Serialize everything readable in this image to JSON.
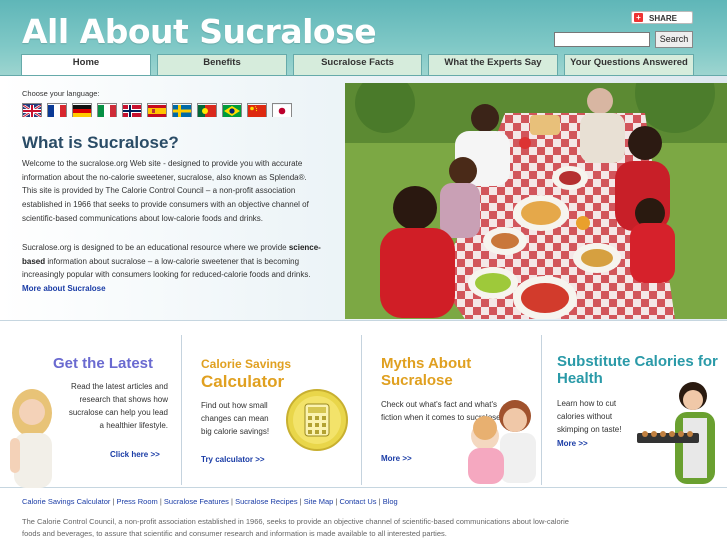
{
  "header": {
    "logo": "All About Sucralose",
    "share_label": "SHARE",
    "search_placeholder": "",
    "search_button": "Search"
  },
  "nav": {
    "tabs": [
      {
        "label": "Home"
      },
      {
        "label": "Benefits"
      },
      {
        "label": "Sucralose Facts"
      },
      {
        "label": "What the Experts Say"
      },
      {
        "label": "Your Questions Answered"
      }
    ]
  },
  "language": {
    "label": "Choose your language:",
    "flags": [
      "uk-flag-icon",
      "france-flag-icon",
      "germany-flag-icon",
      "italy-flag-icon",
      "norway-flag-icon",
      "spain-flag-icon",
      "sweden-flag-icon",
      "portugal-flag-icon",
      "brazil-flag-icon",
      "china-flag-icon",
      "japan-flag-icon"
    ]
  },
  "intro": {
    "title": "What is Sucralose?",
    "p1": "Welcome to the sucralose.org Web site - designed to provide you with accurate information about the no-calorie sweetener, sucralose, also known as Splenda®. This site is provided by The Calorie Control Council – a non-profit association established in 1966 that seeks to provide consumers with an objective channel of scientific-based communications about low-calorie foods and drinks.",
    "p2_a": "Sucralose.org is designed to be an educational resource where we provide ",
    "p2_bold": "science-based",
    "p2_b": " information about sucralose – a low-calorie sweetener that is becoming increasingly popular with consumers looking for reduced-calorie foods and drinks. ",
    "p2_link": "More about Sucralose"
  },
  "promos": {
    "latest": {
      "title": "Get the Latest",
      "text": "Read the latest articles and research that shows how sucralose can help you lead a healthier lifestyle.",
      "link": "Click here >>"
    },
    "calculator": {
      "title1": "Calorie Savings",
      "title2": "Calculator",
      "text": "Find out how small changes can mean big calorie savings!",
      "link": "Try calculator >>"
    },
    "myths": {
      "title": "Myths About Sucralose",
      "text": "Check out what's fact and what's fiction when it comes to sucralose.",
      "link": "More >>"
    },
    "substitute": {
      "title": "Substitute Calories for Health",
      "text": "Learn how to cut calories without skimping on taste!",
      "link": "More >>"
    }
  },
  "footer": {
    "links": [
      "Calorie Savings Calculator",
      "Press Room",
      "Sucralose Features",
      "Sucralose Recipes",
      "Site Map",
      "Contact Us",
      "Blog"
    ],
    "text": "The Calorie Control Council, a non-profit association established in 1966, seeks to provide an objective channel of scientific-based communications about low-calorie foods and beverages, to assure that scientific and consumer research and information is made available to all interested parties."
  },
  "colors": {
    "header_teal": "#6fbfbe",
    "link_blue": "#1a3ca6",
    "promo_purple": "#6a6ad0",
    "promo_orange": "#e0a020",
    "promo_teal": "#2a9aa8"
  }
}
